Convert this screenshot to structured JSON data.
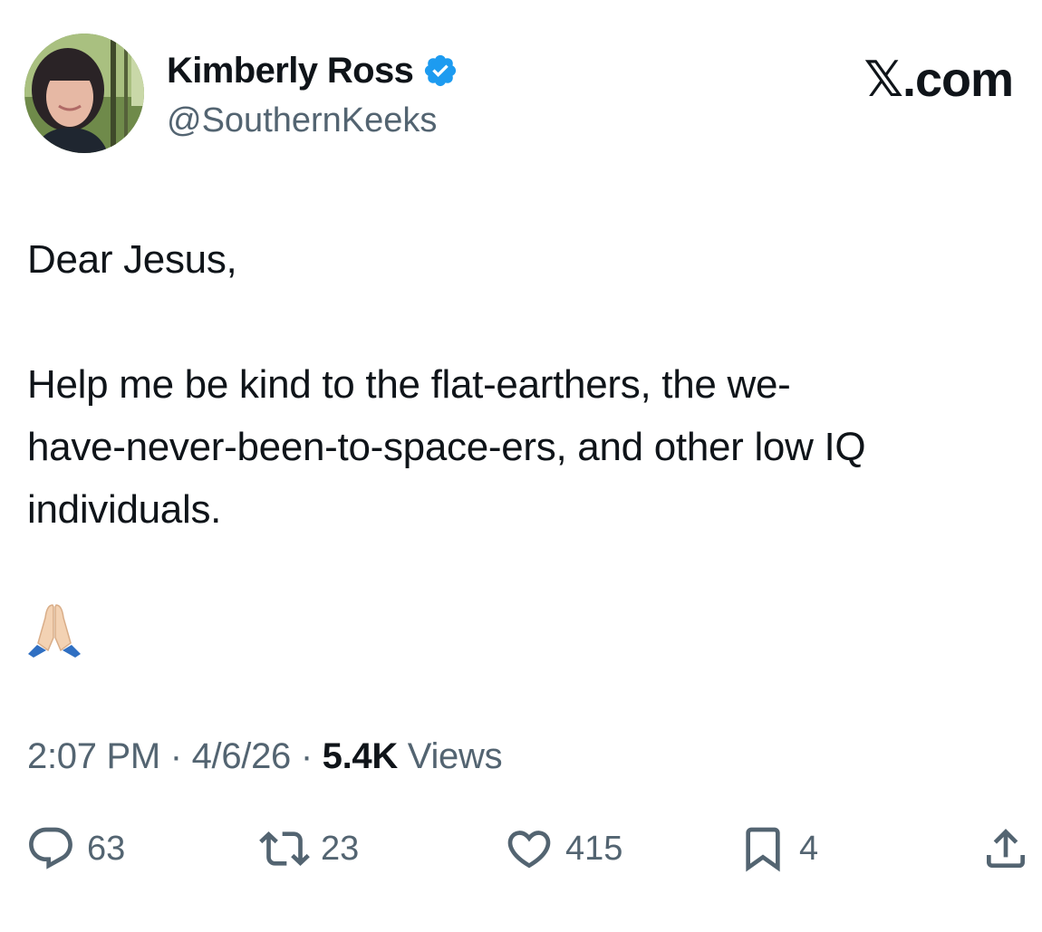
{
  "author": {
    "name": "Kimberly Ross",
    "handle": "@SouthernKeeks",
    "verified_color": "#1d9bf0"
  },
  "brand": "𝕏.com",
  "tweet": {
    "lines": [
      "Dear Jesus,",
      "Help me be kind to the flat-earthers, the we-",
      "have-never-been-to-space-ers, and other low IQ",
      "individuals."
    ],
    "emoji": "folded-hands"
  },
  "meta": {
    "time": "2:07 PM",
    "date": "4/6/26",
    "views_count": "5.4K",
    "views_label": "Views",
    "separator": "·"
  },
  "actions": {
    "replies": "63",
    "reposts": "23",
    "likes": "415",
    "bookmarks": "4"
  },
  "colors": {
    "text": "#0f1419",
    "secondary": "#536471",
    "accent": "#1d9bf0"
  }
}
